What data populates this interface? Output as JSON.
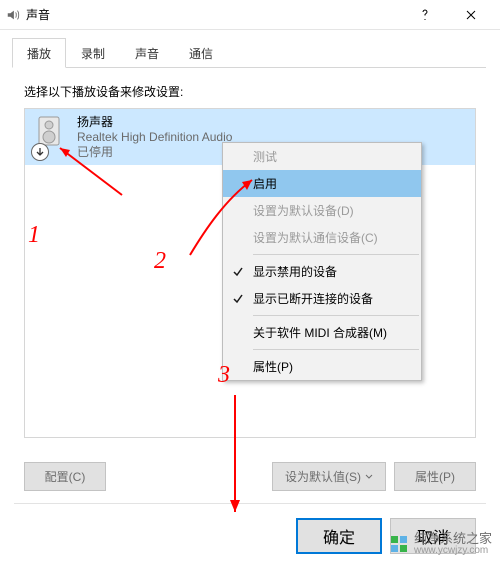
{
  "title": "声音",
  "tabs": {
    "playback": "播放",
    "recording": "录制",
    "sound": "声音",
    "comm": "通信"
  },
  "desc": "选择以下播放设备来修改设置:",
  "device": {
    "name": "扬声器",
    "driver": "Realtek High Definition Audio",
    "status": "已停用"
  },
  "ctx": {
    "test": "测试",
    "enable": "启用",
    "set_default": "设置为默认设备(D)",
    "set_comm": "设置为默认通信设备(C)",
    "show_disabled": "显示禁用的设备",
    "show_disconnected": "显示已断开连接的设备",
    "about_midi": "关于软件 MIDI 合成器(M)",
    "properties": "属性(P)"
  },
  "buttons": {
    "configure": "配置(C)",
    "set_default_btn": "设为默认值(S)",
    "props": "属性(P)",
    "ok": "确定",
    "cancel": "取消"
  },
  "annotations": {
    "n1": "1",
    "n2": "2",
    "n3": "3"
  },
  "watermark": "纯净系统之家",
  "watermark_url": "www.ycwjzy.com"
}
